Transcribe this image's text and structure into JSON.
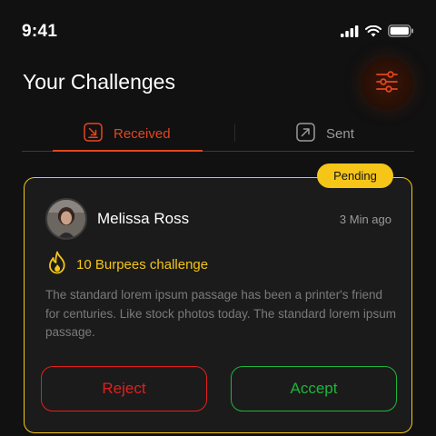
{
  "status_bar": {
    "time": "9:41",
    "icons": [
      "signal-icon",
      "wifi-icon",
      "battery-icon"
    ]
  },
  "header": {
    "title": "Your Challenges",
    "filter_icon": "sliders-icon"
  },
  "tabs": [
    {
      "label": "Received",
      "icon": "arrow-down-right-icon",
      "active": true
    },
    {
      "label": "Sent",
      "icon": "arrow-up-right-icon",
      "active": false
    }
  ],
  "challenge_card": {
    "status": "Pending",
    "user_name": "Melissa Ross",
    "time_ago": "3 Min ago",
    "challenge_icon": "flame-icon",
    "challenge_title": "10 Burpees challenge",
    "description": "The standard lorem ipsum passage has been a printer's friend for centuries. Like stock photos today. The standard lorem ipsum passage.",
    "reject_label": "Reject",
    "accept_label": "Accept"
  },
  "colors": {
    "accent": "#e5451f",
    "pending": "#f5c518",
    "reject": "#e0201e",
    "accept": "#1fb53a",
    "background": "#111111"
  }
}
